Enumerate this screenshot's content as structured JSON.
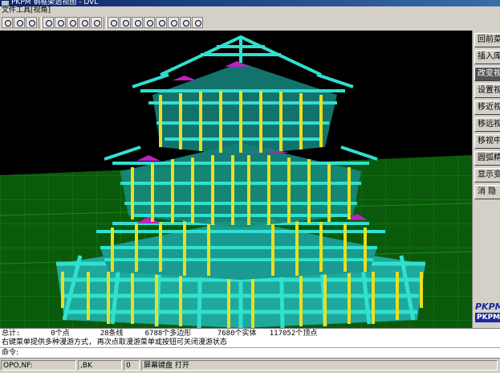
{
  "window": {
    "title": "PKPM 钢框架透视图 - DVL"
  },
  "menu": {
    "items": [
      "文件工具",
      "[视角]"
    ]
  },
  "toolbar": {
    "icons": [
      "print-icon",
      "open-icon",
      "draw-icon",
      "rotate-icon",
      "camera-icon",
      "grid-icon",
      "layer-icon",
      "refresh-icon",
      "pan-icon",
      "zoom-window-icon",
      "zoom-in-icon",
      "move-icon",
      "zoom-all-icon",
      "zoom-plus-icon",
      "zoom-minus-icon"
    ]
  },
  "side_menu": {
    "items": [
      {
        "label": "回前菜单",
        "active": false
      },
      {
        "label": "插入库",
        "active": false
      },
      {
        "label": "改变视",
        "active": true
      },
      {
        "label": "设置视",
        "active": false
      },
      {
        "label": "移近视",
        "active": false
      },
      {
        "label": "移远视",
        "active": false
      },
      {
        "label": "移视中",
        "active": false
      },
      {
        "label": "圆弧精",
        "active": false
      },
      {
        "label": "显示变",
        "active": false
      },
      {
        "label": "消 隐",
        "active": false
      }
    ]
  },
  "logo": {
    "line1": "PKPM",
    "line2": "PKPM"
  },
  "console": {
    "line1": "总计:       0个点       28条线     6788个多边形      7680个实体   117052个顶点",
    "line2": "右键菜单提供多种漫游方式, 再次点取漫游菜单或按钮可关闭漫游状态"
  },
  "command": {
    "prompt": "命令:"
  },
  "status": {
    "coords": "OPO,NF:",
    "bk_label": ",BK",
    "bk_value": "0",
    "screen_kb": "屏幕键盘 打开"
  },
  "colors": {
    "background": "#000000",
    "ground": "#0a5a0a",
    "beam": "#2fd6c8",
    "column": "#e8e020",
    "accent": "#c020c0"
  }
}
